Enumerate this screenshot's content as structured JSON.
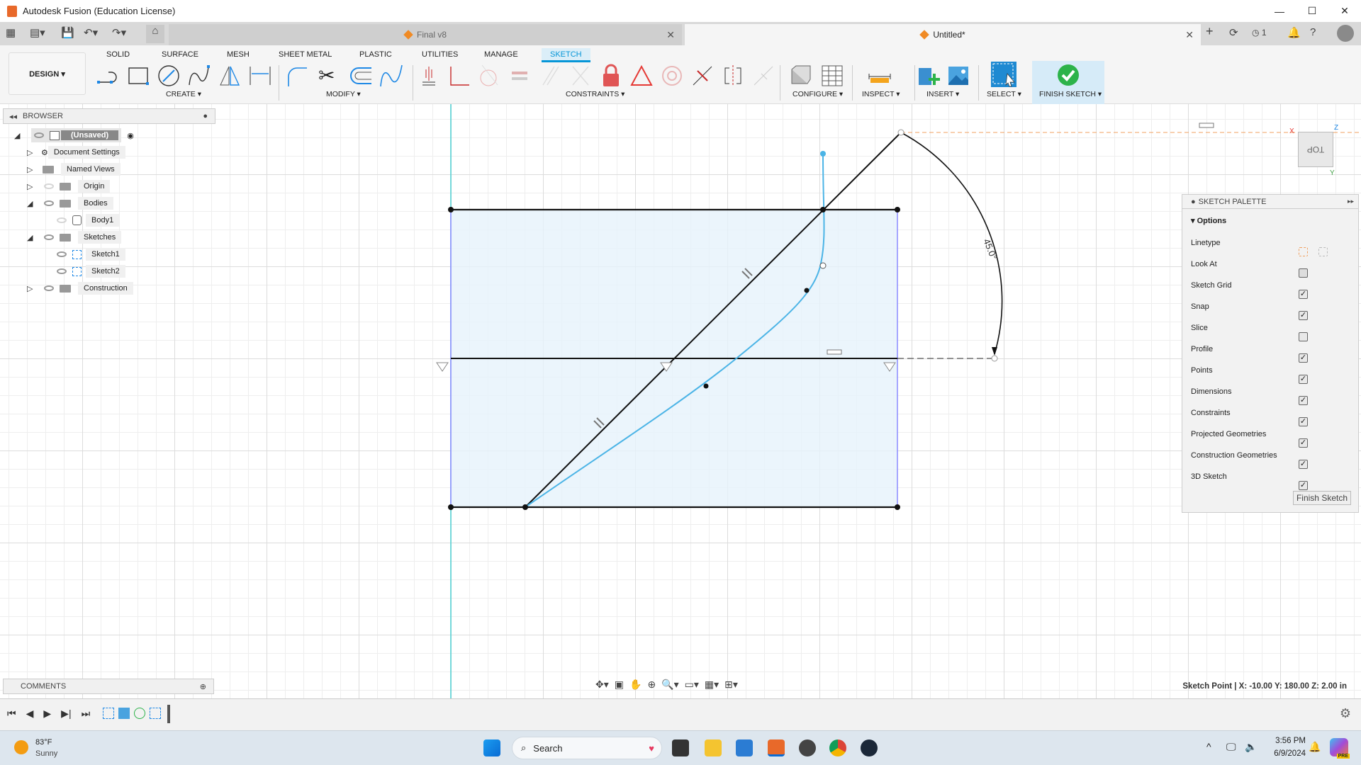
{
  "window": {
    "title": "Autodesk Fusion (Education License)",
    "minimize": "—",
    "maximize": "☐",
    "close": "✕"
  },
  "tabs": [
    {
      "label": "Final v8",
      "active": false
    },
    {
      "label": "Untitled*",
      "active": true
    }
  ],
  "tabbar_right": {
    "jobs_count": "1"
  },
  "ribbon": {
    "workspace": "DESIGN ▾",
    "tabs": [
      "SOLID",
      "SURFACE",
      "MESH",
      "SHEET METAL",
      "PLASTIC",
      "UTILITIES",
      "MANAGE",
      "SKETCH"
    ],
    "active_tab": "SKETCH",
    "groups": [
      "CREATE ▾",
      "MODIFY ▾",
      "CONSTRAINTS ▾",
      "CONFIGURE ▾",
      "INSPECT ▾",
      "INSERT ▾",
      "SELECT ▾",
      "FINISH SKETCH ▾"
    ]
  },
  "browser": {
    "title": "BROWSER",
    "items": [
      {
        "label": "(Unsaved)",
        "expanded": true,
        "visible": true
      },
      {
        "label": "Document Settings",
        "expanded": false
      },
      {
        "label": "Named Views",
        "expanded": false
      },
      {
        "label": "Origin",
        "expanded": false,
        "visible": false
      },
      {
        "label": "Bodies",
        "expanded": true,
        "visible": true
      },
      {
        "label": "Body1",
        "visible": false
      },
      {
        "label": "Sketches",
        "expanded": true,
        "visible": true
      },
      {
        "label": "Sketch1",
        "visible": true
      },
      {
        "label": "Sketch2",
        "visible": true
      },
      {
        "label": "Construction",
        "expanded": false,
        "visible": true
      }
    ]
  },
  "sketch": {
    "angle_dimension": "45.0°"
  },
  "viewcube": {
    "face": "TOP",
    "axes": [
      "X",
      "Y",
      "Z"
    ]
  },
  "palette": {
    "title": "SKETCH PALETTE",
    "section": "Options",
    "rows": [
      {
        "label": "Linetype",
        "type": "icons"
      },
      {
        "label": "Look At",
        "type": "button"
      },
      {
        "label": "Sketch Grid",
        "checked": true
      },
      {
        "label": "Snap",
        "checked": true
      },
      {
        "label": "Slice",
        "checked": false
      },
      {
        "label": "Profile",
        "checked": true
      },
      {
        "label": "Points",
        "checked": true
      },
      {
        "label": "Dimensions",
        "checked": true
      },
      {
        "label": "Constraints",
        "checked": true
      },
      {
        "label": "Projected Geometries",
        "checked": true
      },
      {
        "label": "Construction Geometries",
        "checked": true
      },
      {
        "label": "3D Sketch",
        "checked": true
      }
    ],
    "finish": "Finish Sketch"
  },
  "comments": {
    "title": "COMMENTS"
  },
  "status": "Sketch Point | X: -10.00 Y: 180.00 Z: 2.00 in",
  "taskbar": {
    "weather_temp": "83°F",
    "weather_desc": "Sunny",
    "search": "Search",
    "time": "3:56 PM",
    "date": "6/9/2024",
    "copilot_badge": "PRE"
  },
  "colors": {
    "accent": "#0696d7",
    "profile_fill": "#e6f2fb",
    "spline": "#4bb4e6",
    "finish_green": "#2db34a",
    "dim_orange": "#f0a060"
  }
}
